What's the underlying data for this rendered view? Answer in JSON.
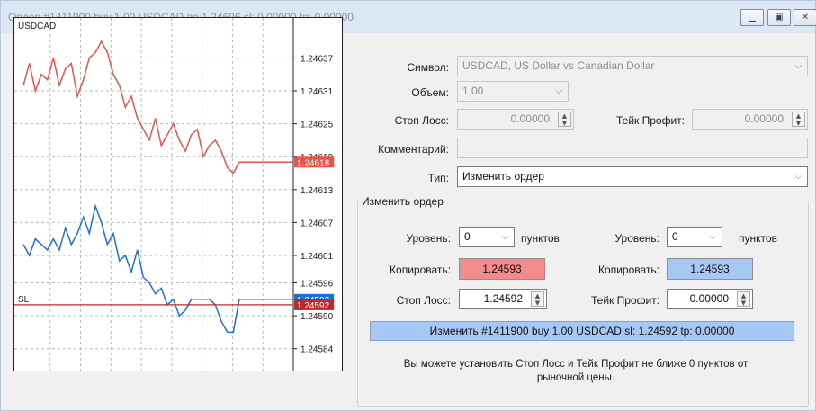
{
  "window": {
    "title": "Ордер #1411900 buy 1.00 USDCAD по 1.24696 sl: 0.00000 tp: 0.00000",
    "minimize_icon": "minimize-icon",
    "maximize_icon": "maximize-icon",
    "close_icon": "close-icon"
  },
  "form": {
    "symbol_label": "Символ:",
    "symbol_value": "USDCAD, US Dollar vs Canadian Dollar",
    "volume_label": "Объем:",
    "volume_value": "1.00",
    "stoploss_label": "Стоп Лосс:",
    "stoploss_value": "0.00000",
    "takeprofit_label": "Тейк Профит:",
    "takeprofit_value": "0.00000",
    "comment_label": "Комментарий:",
    "comment_value": "",
    "type_label": "Тип:",
    "type_value": "Изменить ордер"
  },
  "modify": {
    "group_title": "Изменить ордер",
    "level_label_left": "Уровень:",
    "level_value_left": "0",
    "points_left": "пунктов",
    "level_label_right": "Уровень:",
    "level_value_right": "0",
    "points_right": "пунктов",
    "copy_label_left": "Копировать:",
    "copy_value_left": "1.24593",
    "copy_label_right": "Копировать:",
    "copy_value_right": "1.24593",
    "sl_label": "Стоп Лосс:",
    "sl_value": "1.24592",
    "tp_label": "Тейк Профит:",
    "tp_value": "0.00000",
    "button_label": "Изменить #1411900 buy 1.00 USDCAD sl: 1.24592 tp: 0.00000",
    "note_line1": "Вы можете установить Стоп Лосс и Тейк Профит не ближе 0 пунктов от",
    "note_line2": "рыночной цены."
  },
  "colors": {
    "ask_line": "#e8534a",
    "bid_line": "#1f6fd6",
    "sl_line": "#c0262b",
    "copy_left_bg": "#f28b8b",
    "copy_right_bg": "#a7c8f5"
  },
  "chart_data": {
    "type": "line",
    "title": "USDCAD",
    "ylim": [
      1.24581,
      1.24641
    ],
    "yticks": [
      "1.24637",
      "1.24631",
      "1.24625",
      "1.24619",
      "1.24613",
      "1.24607",
      "1.24601",
      "1.24596",
      "1.24590",
      "1.24584"
    ],
    "yticks_values": [
      1.24637,
      1.24631,
      1.24625,
      1.24619,
      1.24613,
      1.24607,
      1.24601,
      1.24596,
      1.2459,
      1.24584
    ],
    "current_ask": "1.24618",
    "current_bid": "1.24593",
    "sl_tag": "SL",
    "sl_price": "1.24592",
    "grid": true,
    "series": [
      {
        "color": "#e8534a",
        "values": [
          1.24632,
          1.24636,
          1.24631,
          1.24634,
          1.24633,
          1.24637,
          1.24632,
          1.24635,
          1.24636,
          1.2463,
          1.24633,
          1.24637,
          1.24638,
          1.2464,
          1.24638,
          1.24634,
          1.24632,
          1.24628,
          1.2463,
          1.24626,
          1.24624,
          1.24622,
          1.24626,
          1.24621,
          1.24623,
          1.24625,
          1.24622,
          1.2462,
          1.24623,
          1.24624,
          1.24619,
          1.24621,
          1.24622,
          1.2462,
          1.24617,
          1.24616,
          1.24618,
          1.24618,
          1.24618,
          1.24618,
          1.24618,
          1.24618,
          1.24618,
          1.24618,
          1.24618,
          1.24618
        ]
      },
      {
        "color": "#1f6fd6",
        "values": [
          1.24603,
          1.24601,
          1.24604,
          1.24603,
          1.24602,
          1.24604,
          1.24602,
          1.24606,
          1.24603,
          1.24605,
          1.24608,
          1.24605,
          1.2461,
          1.24607,
          1.24603,
          1.24605,
          1.246,
          1.24601,
          1.24598,
          1.24602,
          1.24597,
          1.24596,
          1.24594,
          1.24595,
          1.24592,
          1.24593,
          1.2459,
          1.24591,
          1.24593,
          1.24593,
          1.24593,
          1.24593,
          1.24592,
          1.24589,
          1.24587,
          1.24587,
          1.24593,
          1.24593,
          1.24593,
          1.24593,
          1.24593,
          1.24593,
          1.24593,
          1.24593,
          1.24593,
          1.24593
        ]
      }
    ]
  }
}
